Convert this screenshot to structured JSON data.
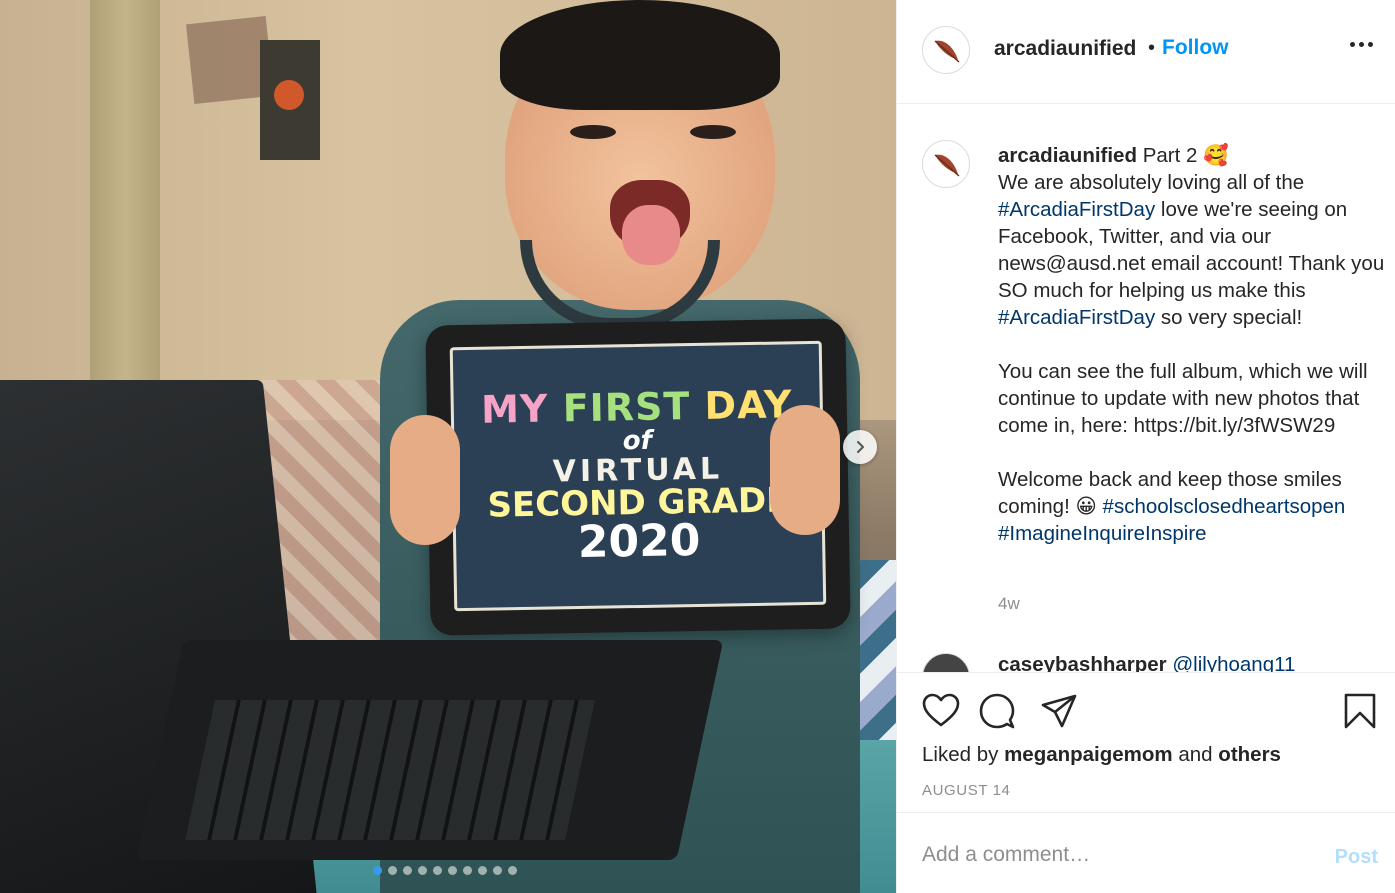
{
  "photo": {
    "sign_lines": [
      "MY FIRST DAY",
      "of",
      "VIRTUAL",
      "SECOND GRADE",
      "2020"
    ],
    "sign_words_line1": [
      "MY",
      "FIRST",
      "DAY"
    ],
    "carousel": {
      "total": 10,
      "active_index": 0
    },
    "next_icon": "chevron-right-icon"
  },
  "header": {
    "username": "arcadiaunified",
    "bullet": "•",
    "follow_label": "Follow",
    "more_icon": "more-horizontal-icon",
    "avatar_icon": "feather-icon"
  },
  "caption": {
    "username": "arcadiaunified",
    "lead": "Part 2 🥰",
    "line_a": "We are absolutely loving all of the",
    "hashtag1": "#ArcadiaFirstDay",
    "line_b": " love we're seeing on Facebook, Twitter, and via our news@ausd.net email account! Thank you SO much for helping us make this ",
    "hashtag2": "#ArcadiaFirstDay",
    "line_c": " so very special!",
    "para2": "You can see the full album, which we will continue to update with new photos that come in, here: https://bit.ly/3fWSW29",
    "para3_text": "Welcome back and keep those smiles coming! 😀 ",
    "hashtag3": "#schoolsclosedheartsopen",
    "hashtag4": "#ImagineInquireInspire",
    "time": "4w"
  },
  "next_comment": {
    "username": "caseybashharper",
    "mention": "@lilyhoang11"
  },
  "actions": {
    "like_icon": "heart-icon",
    "comment_icon": "comment-icon",
    "share_icon": "share-icon",
    "save_icon": "bookmark-icon",
    "liked_by_prefix": "Liked by",
    "liked_by_user": "meganpaigemom",
    "liked_by_and": "and",
    "liked_by_others": "others",
    "date": "AUGUST 14"
  },
  "comment_box": {
    "placeholder": "Add a comment…",
    "post_label": "Post"
  },
  "colors": {
    "link_blue": "#0095f6",
    "hashtag_blue": "#00376b",
    "post_disabled": "#b2dffc",
    "muted_gray": "#8e8e8e"
  }
}
